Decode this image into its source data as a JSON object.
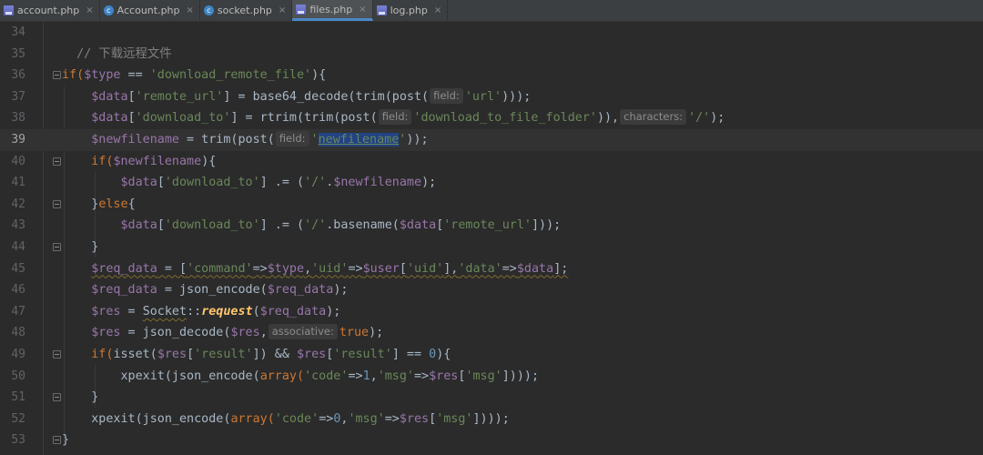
{
  "tabs": [
    {
      "label": "account.php",
      "icon": "php-file-icon",
      "active": false
    },
    {
      "label": "Account.php",
      "icon": "class-file-icon",
      "active": false
    },
    {
      "label": "socket.php",
      "icon": "class-file-icon",
      "active": false
    },
    {
      "label": "files.php",
      "icon": "php-file-icon",
      "active": true
    },
    {
      "label": "log.php",
      "icon": "php-file-icon",
      "active": false
    }
  ],
  "close_glyph": "×",
  "lines": [
    "34",
    "35",
    "36",
    "37",
    "38",
    "39",
    "40",
    "41",
    "42",
    "43",
    "44",
    "45",
    "46",
    "47",
    "48",
    "49",
    "50",
    "51",
    "52",
    "53"
  ],
  "code": {
    "l35_comment": "// 下载远程文件",
    "l36": {
      "kw": "if(",
      "var": "$type",
      "op": " == ",
      "str": "'download_remote_file'",
      "end": "){"
    },
    "l37": {
      "var": "$data",
      "s1": "'remote_url'",
      "mid": "] = base64_decode(trim(post(",
      "hint": "field:",
      "s2": "'url'",
      "end": ")));"
    },
    "l38": {
      "var": "$data",
      "s1": "'download_to'",
      "mid": "] = rtrim(trim(post(",
      "hint1": "field:",
      "s2": "'download_to_file_folder'",
      "mid2": ")),",
      "hint2": "characters:",
      "s3": "'/'",
      "end": ");"
    },
    "l39": {
      "var": "$newfilename",
      "mid": " = trim(post(",
      "hint": "field:",
      "q1": "'",
      "sel": "newfilename",
      "q2": "'",
      "end": "));"
    },
    "l40": {
      "kw": "if(",
      "var": "$newfilename",
      "end": "){"
    },
    "l41": {
      "var": "$data",
      "s1": "'download_to'",
      "mid": "] .= (",
      "s2": "'/'",
      "dot": ".",
      "var2": "$newfilename",
      "end": ");"
    },
    "l42": {
      "pre": "}",
      "kw": "else",
      "end": "{"
    },
    "l43": {
      "var": "$data",
      "s1": "'download_to'",
      "mid": "] .= (",
      "s2": "'/'",
      "fn": ".basename(",
      "var2": "$data",
      "s3": "'remote_url'",
      "end": "]));"
    },
    "l44": "}",
    "l45": {
      "var": "$req_data",
      "mid": " = [",
      "s1": "'command'",
      "a1": "=>",
      "v1": "$type",
      "c1": ",",
      "s2": "'uid'",
      "a2": "=>",
      "v2": "$user",
      "s3": "'uid'",
      "c2": "],",
      "s4": "'data'",
      "a3": "=>",
      "v3": "$data",
      "end": "];"
    },
    "l46": {
      "var": "$req_data",
      "mid": " = json_encode(",
      "var2": "$req_data",
      "end": ");"
    },
    "l47": {
      "var": "$res",
      "mid": " = ",
      "cls": "Socket",
      "sep": "::",
      "st": "request",
      "p": "(",
      "var2": "$req_data",
      "end": ");"
    },
    "l48": {
      "var": "$res",
      "mid": " = json_decode(",
      "var2": "$res",
      "c": ",",
      "hint": "associative:",
      "kw": "true",
      "end": ");"
    },
    "l49": {
      "kw": "if(",
      "fn": "isset(",
      "var": "$res",
      "s1": "'result'",
      "mid": "]) && ",
      "var2": "$res",
      "s2": "'result'",
      "mid2": "] == ",
      "num": "0",
      "end": "){"
    },
    "l50": {
      "fn": "xpexit(json_encode(",
      "kw": "array(",
      "s1": "'code'",
      "a1": "=>",
      "num": "1",
      "c": ",",
      "s2": "'msg'",
      "a2": "=>",
      "var": "$res",
      "s3": "'msg'",
      "end": "])));"
    },
    "l51": "}",
    "l52": {
      "fn": "xpexit(json_encode(",
      "kw": "array(",
      "s1": "'code'",
      "a1": "=>",
      "num": "0",
      "c": ",",
      "s2": "'msg'",
      "a2": "=>",
      "var": "$res",
      "s3": "'msg'",
      "end": "])));"
    },
    "l53": "}"
  },
  "colors": {
    "keyword": "#cc7832",
    "variable": "#9876aa",
    "string": "#6a8759",
    "number": "#6897bb",
    "static_call": "#ffc66d",
    "comment": "#808080"
  }
}
